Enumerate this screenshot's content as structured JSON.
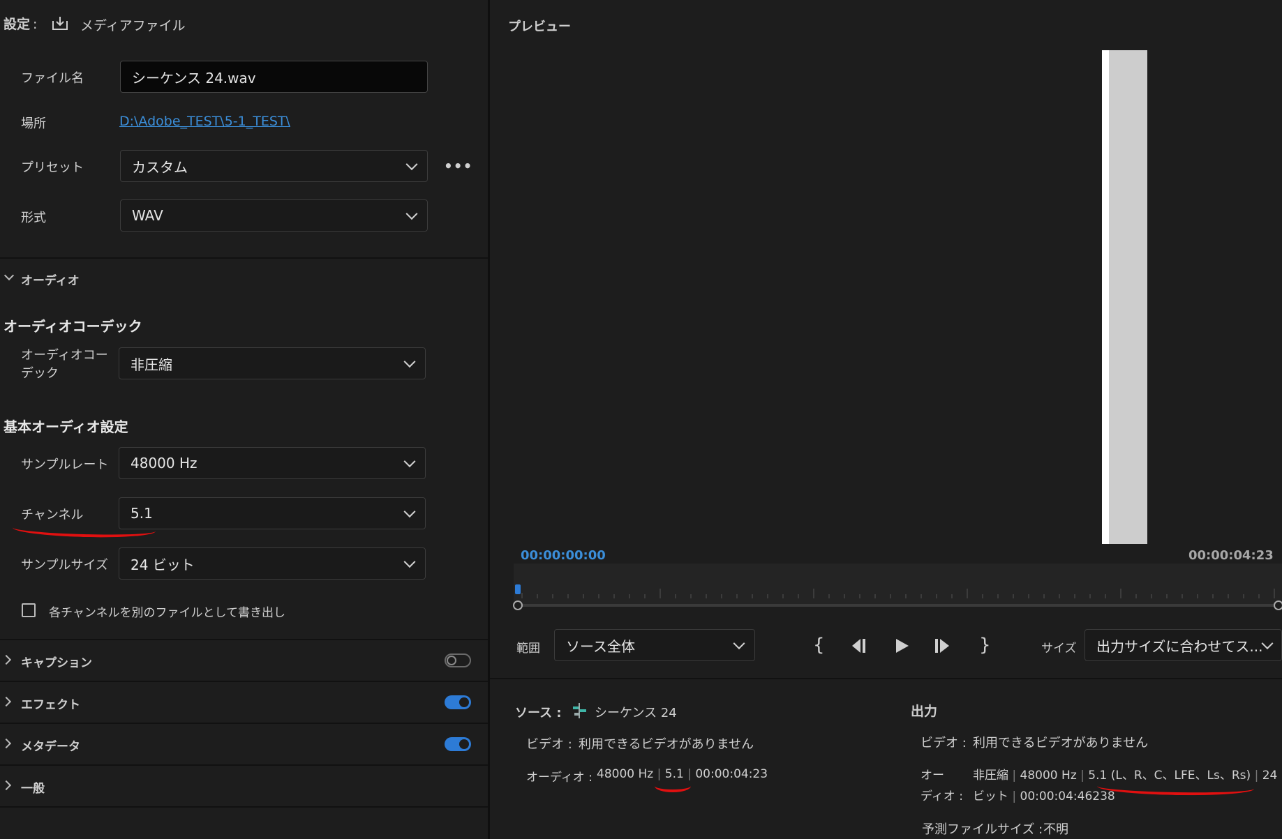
{
  "settings": {
    "title": "設定",
    "title_colon": ":",
    "media_file_label": "メディアファイル",
    "file_name_label": "ファイル名",
    "file_name_value": "シーケンス 24.wav",
    "location_label": "場所",
    "location_value": "D:\\Adobe_TEST\\5-1_TEST\\",
    "preset_label": "プリセット",
    "preset_value": "カスタム",
    "format_label": "形式",
    "format_value": "WAV"
  },
  "audio": {
    "section_label": "オーディオ",
    "codec_heading": "オーディオコーデック",
    "codec_label": "オーディオコーデック",
    "codec_value": "非圧縮",
    "basic_heading": "基本オーディオ設定",
    "sample_rate_label": "サンプルレート",
    "sample_rate_value": "48000 Hz",
    "channel_label": "チャンネル",
    "channel_value": "5.1",
    "sample_size_label": "サンプルサイズ",
    "sample_size_value": "24 ビット",
    "separate_files_label": "各チャンネルを別のファイルとして書き出し",
    "separate_files_checked": false
  },
  "accordions": [
    {
      "label": "キャプション",
      "toggle": false
    },
    {
      "label": "エフェクト",
      "toggle": true
    },
    {
      "label": "メタデータ",
      "toggle": true
    },
    {
      "label": "一般",
      "toggle": null
    }
  ],
  "preview": {
    "title": "プレビュー",
    "timecode_start": "00:00:00:00",
    "timecode_end": "00:00:04:23",
    "range_label": "範囲",
    "range_value": "ソース全体",
    "size_label": "サイズ",
    "size_value": "出力サイズに合わせてス..."
  },
  "source": {
    "label": "ソース :",
    "sequence_name": "シーケンス 24",
    "video_label": "ビデオ :",
    "video_value": "利用できるビデオがありません",
    "audio_label": "オーディオ :",
    "audio_rate": "48000 Hz",
    "audio_channels": "5.1",
    "audio_duration": "00:00:04:23"
  },
  "output": {
    "label": "出力",
    "video_label": "ビデオ :",
    "video_value": "利用できるビデオがありません",
    "audio_label_1": "オー",
    "audio_label_2": "ディオ :",
    "audio_codec": "非圧縮",
    "audio_rate": "48000 Hz",
    "audio_channels": "5.1 (L、R、C、LFE、Ls、Rs)",
    "audio_bits_1": "24",
    "audio_bits_2": "ビット",
    "audio_duration": "00:00:04:46238",
    "est_size_label": "予測ファイルサイズ :",
    "est_size_value": "不明"
  },
  "colors": {
    "accent": "#2d7bd6",
    "link": "#3b8ed9",
    "annotation": "#e01010",
    "background": "#1d1d1d"
  }
}
